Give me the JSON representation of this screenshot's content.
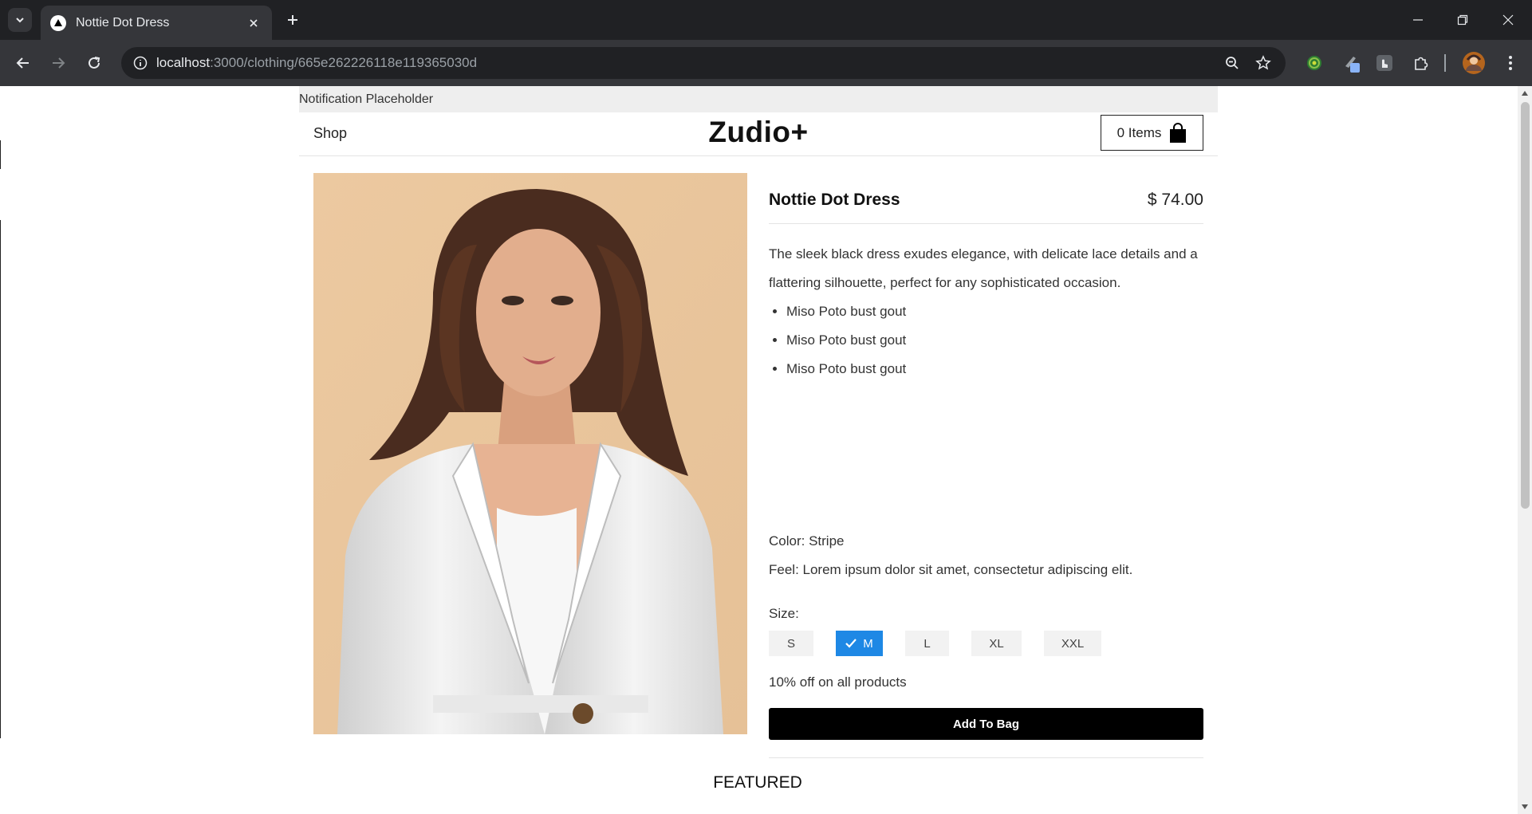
{
  "browser": {
    "tab_title": "Nottie Dot Dress",
    "url_host": "localhost",
    "url_path": ":3000/clothing/665e262226118e119365030d"
  },
  "page": {
    "notification": "Notification Placeholder",
    "header": {
      "shop_label": "Shop",
      "logo": "Zudio+",
      "cart_label": "0 Items"
    },
    "product": {
      "title": "Nottie Dot Dress",
      "price": "$ 74.00",
      "description": "The sleek black dress exudes elegance, with delicate lace details and a flattering silhouette, perfect for any sophisticated occasion.",
      "features": [
        "Miso Poto bust gout",
        "Miso Poto bust gout",
        "Miso Poto bust gout"
      ],
      "color_line": "Color: Stripe",
      "feel_line": "Feel: Lorem ipsum dolor sit amet, consectetur adipiscing elit.",
      "size_label": "Size:",
      "sizes": [
        "S",
        "M",
        "L",
        "XL",
        "XXL"
      ],
      "selected_size": "M",
      "promo": "10% off on all products",
      "add_to_bag": "Add To Bag"
    },
    "featured_heading": "FEATURED"
  },
  "colors": {
    "accent": "#1e88e5",
    "button_bg": "#000000",
    "image_backdrop": "#e8c49a"
  }
}
